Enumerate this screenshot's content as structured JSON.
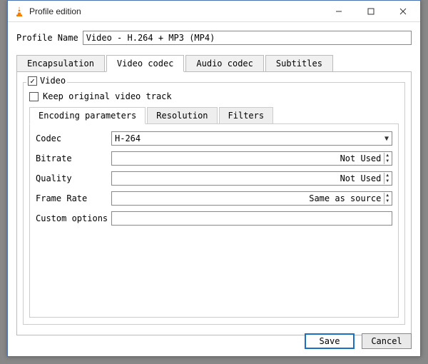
{
  "window": {
    "title": "Profile edition"
  },
  "profile": {
    "label": "Profile Name",
    "value": "Video - H.264 + MP3 (MP4)"
  },
  "outerTabs": {
    "encapsulation": "Encapsulation",
    "videoCodec": "Video codec",
    "audioCodec": "Audio codec",
    "subtitles": "Subtitles"
  },
  "videoGroup": {
    "legend": "Video",
    "videoChecked": true,
    "keepOriginal": "Keep original video track",
    "keepOriginalChecked": false
  },
  "innerTabs": {
    "encoding": "Encoding parameters",
    "resolution": "Resolution",
    "filters": "Filters"
  },
  "fields": {
    "codec": {
      "label": "Codec",
      "value": "H-264"
    },
    "bitrate": {
      "label": "Bitrate",
      "value": "Not Used"
    },
    "quality": {
      "label": "Quality",
      "value": "Not Used"
    },
    "frameRate": {
      "label": "Frame Rate",
      "value": "Same as source"
    },
    "custom": {
      "label": "Custom options",
      "value": ""
    }
  },
  "buttons": {
    "save": "Save",
    "cancel": "Cancel"
  }
}
